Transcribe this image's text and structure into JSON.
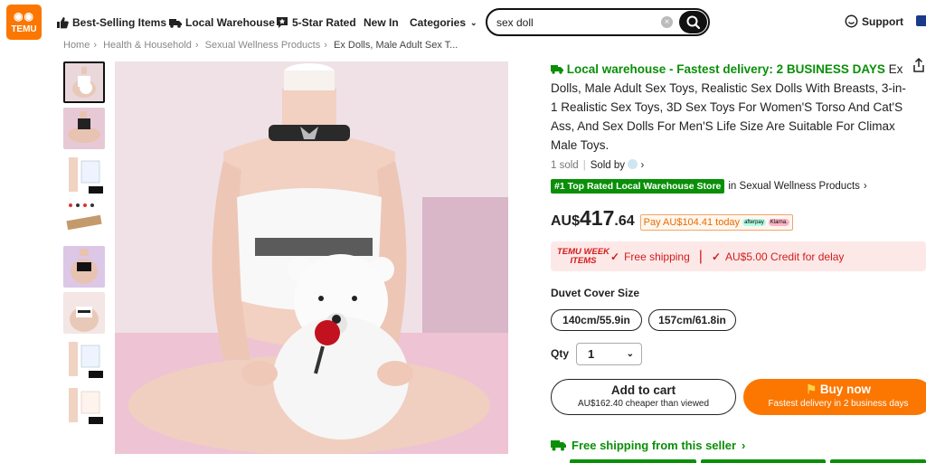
{
  "header": {
    "logo_glyph": "🛍︎",
    "logo_text": "TEMU",
    "nav": [
      {
        "label": "Best-Selling Items",
        "icon": "thumbs-up-icon"
      },
      {
        "label": "Local Warehouse",
        "icon": "truck-icon"
      },
      {
        "label": "5-Star Rated",
        "icon": "star-chat-icon"
      },
      {
        "label": "New In",
        "icon": ""
      },
      {
        "label": "Categories",
        "icon": "chevron-down-icon"
      }
    ],
    "search_value": "sex doll",
    "support_label": "Support"
  },
  "breadcrumb": [
    "Home",
    "Health & Household",
    "Sexual Wellness Products",
    "Ex Dolls, Male Adult Sex T..."
  ],
  "product": {
    "title_green": "Local warehouse - Fastest delivery: 2 BUSINESS DAYS",
    "title_rest": " Ex Dolls, Male Adult Sex Toys, Realistic Sex Dolls With Breasts, 3-in-1 Realistic Sex Toys, 3D Sex Toys For Women'S Torso And Cat'S Ass, And Sex Dolls For Men'S Life Size Are Suitable For Climax Male Toys.",
    "sold": "1 sold",
    "sold_by": "Sold by",
    "badge": "#1 Top Rated Local Warehouse Store",
    "category": "in Sexual Wellness Products",
    "price_currency": "AU$",
    "price_int": "417",
    "price_dec": ".64",
    "pay_text": "Pay AU$104.41 today",
    "pay_pill_1": "afterpay",
    "pay_pill_2": "Klarna.",
    "week_label_1": "TEMU WEEK",
    "week_label_2": "ITEMS",
    "free_shipping": "Free shipping",
    "credit": "AU$5.00 Credit for delay",
    "size_label": "Duvet Cover Size",
    "sizes": [
      "140cm/55.9in",
      "157cm/61.8in"
    ],
    "qty_label": "Qty",
    "qty_value": "1",
    "cart_label": "Add to cart",
    "cart_sub": "AU$162.40 cheaper than viewed",
    "buy_label": "Buy now",
    "buy_sub": "Fastest delivery in 2 business days",
    "free_ship_seller": "Free shipping from this seller"
  },
  "thumbnails": [
    "thumb-1",
    "thumb-2",
    "thumb-3",
    "thumb-4",
    "thumb-5",
    "thumb-6",
    "thumb-7",
    "thumb-8"
  ],
  "colors": {
    "brand_orange": "#fb7701",
    "green": "#0a8f08",
    "red": "#d31c1c"
  }
}
